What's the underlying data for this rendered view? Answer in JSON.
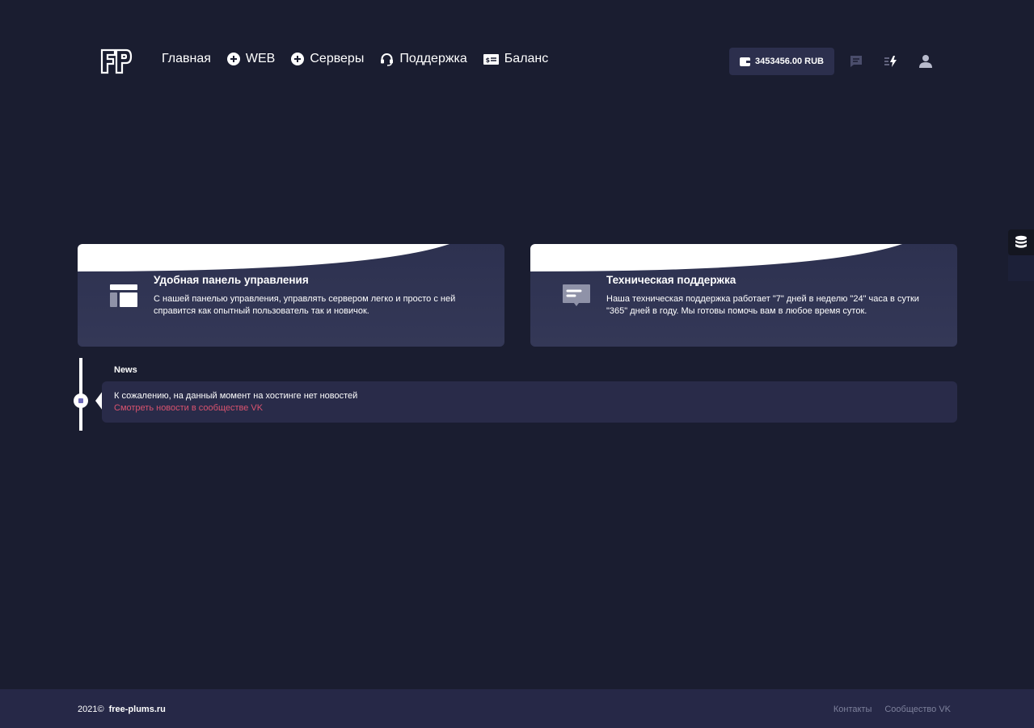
{
  "header": {
    "logo_text": "FP",
    "nav": [
      {
        "label": "Главная",
        "icon": "none"
      },
      {
        "label": "WEB",
        "icon": "plus-circle-icon"
      },
      {
        "label": "Серверы",
        "icon": "plus-circle-icon"
      },
      {
        "label": "Поддержка",
        "icon": "headset-icon"
      },
      {
        "label": "Баланс",
        "icon": "cash-icon"
      }
    ],
    "balance": "3453456.00 RUB",
    "icons": [
      "chat-icon",
      "activity-icon",
      "user-icon"
    ]
  },
  "features": [
    {
      "title": "Удобная панель управления",
      "text": "С нашей панелью управления, управлять сервером легко и просто с ней справится как опытный пользователь так и новичок.",
      "icon": "dashboard-icon"
    },
    {
      "title": "Техническая поддержка",
      "text": "Наша техническая поддержка работает \"7\" дней в неделю \"24\" часа в сутки \"365\" дней в году. Мы готовы помочь вам в любое время суток.",
      "icon": "message-icon"
    }
  ],
  "news": {
    "title": "News",
    "text": "К сожалению, на данный момент на хостинге нет новостей",
    "link": "Смотреть новости в сообществе VK"
  },
  "footer": {
    "copyright": "2021©",
    "site": "free-plums.ru",
    "links": [
      "Контакты",
      "Сообщество VK"
    ]
  },
  "colors": {
    "background": "#1a1d30",
    "card": "#2d3150",
    "footer": "#262847",
    "link": "#d9536f"
  }
}
